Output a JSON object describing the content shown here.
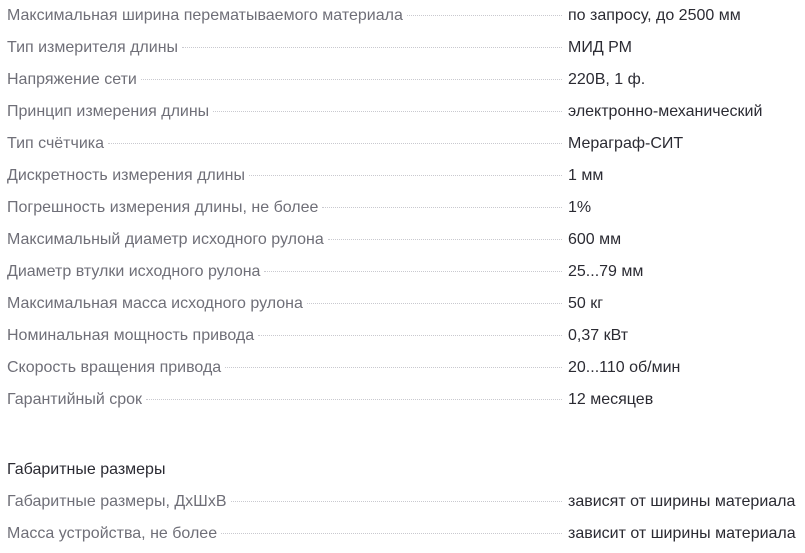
{
  "specs": [
    {
      "label": "Максимальная ширина перематываемого материала",
      "value": "по запросу, до 2500 мм"
    },
    {
      "label": "Тип измерителя длины",
      "value": "МИД РМ"
    },
    {
      "label": "Напряжение сети",
      "value": "220В, 1 ф."
    },
    {
      "label": "Принцип измерения длины",
      "value": "электронно-механический"
    },
    {
      "label": "Тип счётчика",
      "value": "Мераграф-СИТ"
    },
    {
      "label": "Дискретность измерения длины",
      "value": "1 мм"
    },
    {
      "label": "Погрешность измерения длины, не более",
      "value": "1%"
    },
    {
      "label": "Максимальный диаметр исходного рулона",
      "value": "600 мм"
    },
    {
      "label": "Диаметр втулки исходного рулона",
      "value": "25...79 мм"
    },
    {
      "label": "Максимальная масса исходного рулона",
      "value": "50 кг"
    },
    {
      "label": "Номинальная мощность привода",
      "value": "0,37 кВт"
    },
    {
      "label": "Скорость вращения привода",
      "value": "20...110 об/мин"
    },
    {
      "label": "Гарантийный срок",
      "value": "12 месяцев"
    }
  ],
  "dimensions": {
    "heading": "Габаритные размеры",
    "rows": [
      {
        "label": "Габаритные размеры, ДхШхВ",
        "value": "зависят от ширины материала"
      },
      {
        "label": "Масса устройства, не более",
        "value": "зависит от ширины материала"
      }
    ]
  }
}
